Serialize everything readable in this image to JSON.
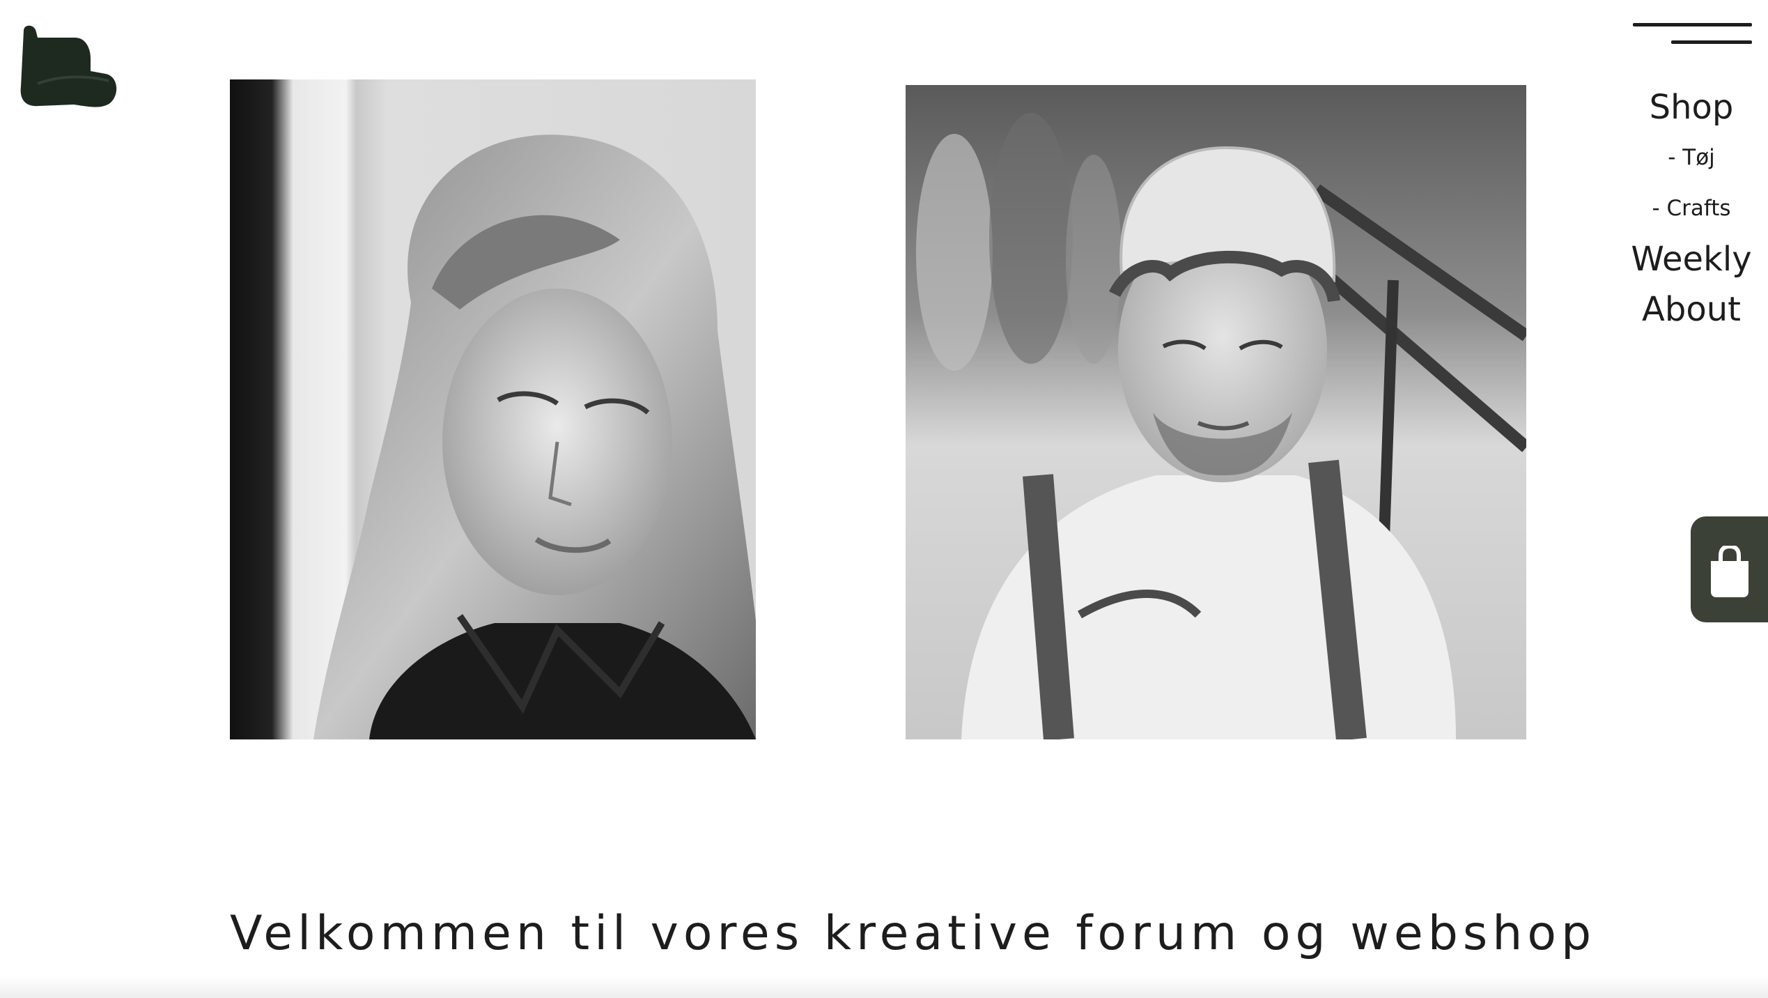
{
  "header": {
    "logo_icon": "boot-logo-icon",
    "menu_icon": "hamburger-menu-icon"
  },
  "nav": {
    "shop": "Shop",
    "toj": "- Tøj",
    "crafts": "- Crafts",
    "weekly": "Weekly",
    "about": "About"
  },
  "hero": {
    "images": [
      {
        "icon": "portrait-woman-photo"
      },
      {
        "icon": "portrait-man-cap-photo"
      }
    ]
  },
  "cart": {
    "icon": "shopping-bag-icon"
  },
  "welcome": {
    "text": "Velkommen til vores kreative forum og webshop"
  },
  "colors": {
    "logo": "#1e2a20",
    "text": "#1d1d1d",
    "cart_bg": "#3c4138"
  }
}
